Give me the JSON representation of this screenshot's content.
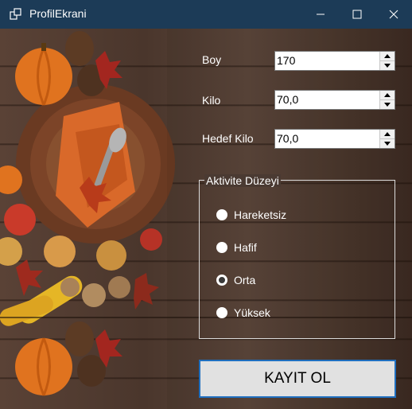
{
  "window": {
    "title": "ProfilEkrani"
  },
  "form": {
    "boy": {
      "label": "Boy",
      "value": "170"
    },
    "kilo": {
      "label": "Kilo",
      "value": "70,0"
    },
    "hedef": {
      "label": "Hedef Kilo",
      "value": "70,0"
    }
  },
  "activity": {
    "title": "Aktivite Düzeyi",
    "options": [
      {
        "label": "Hareketsiz",
        "checked": false
      },
      {
        "label": "Hafif",
        "checked": false
      },
      {
        "label": "Orta",
        "checked": true
      },
      {
        "label": "Yüksek",
        "checked": false
      }
    ]
  },
  "submit_label": "KAYIT OL",
  "colors": {
    "titlebar": "#1c3b57",
    "button_border": "#1f6fbf"
  }
}
